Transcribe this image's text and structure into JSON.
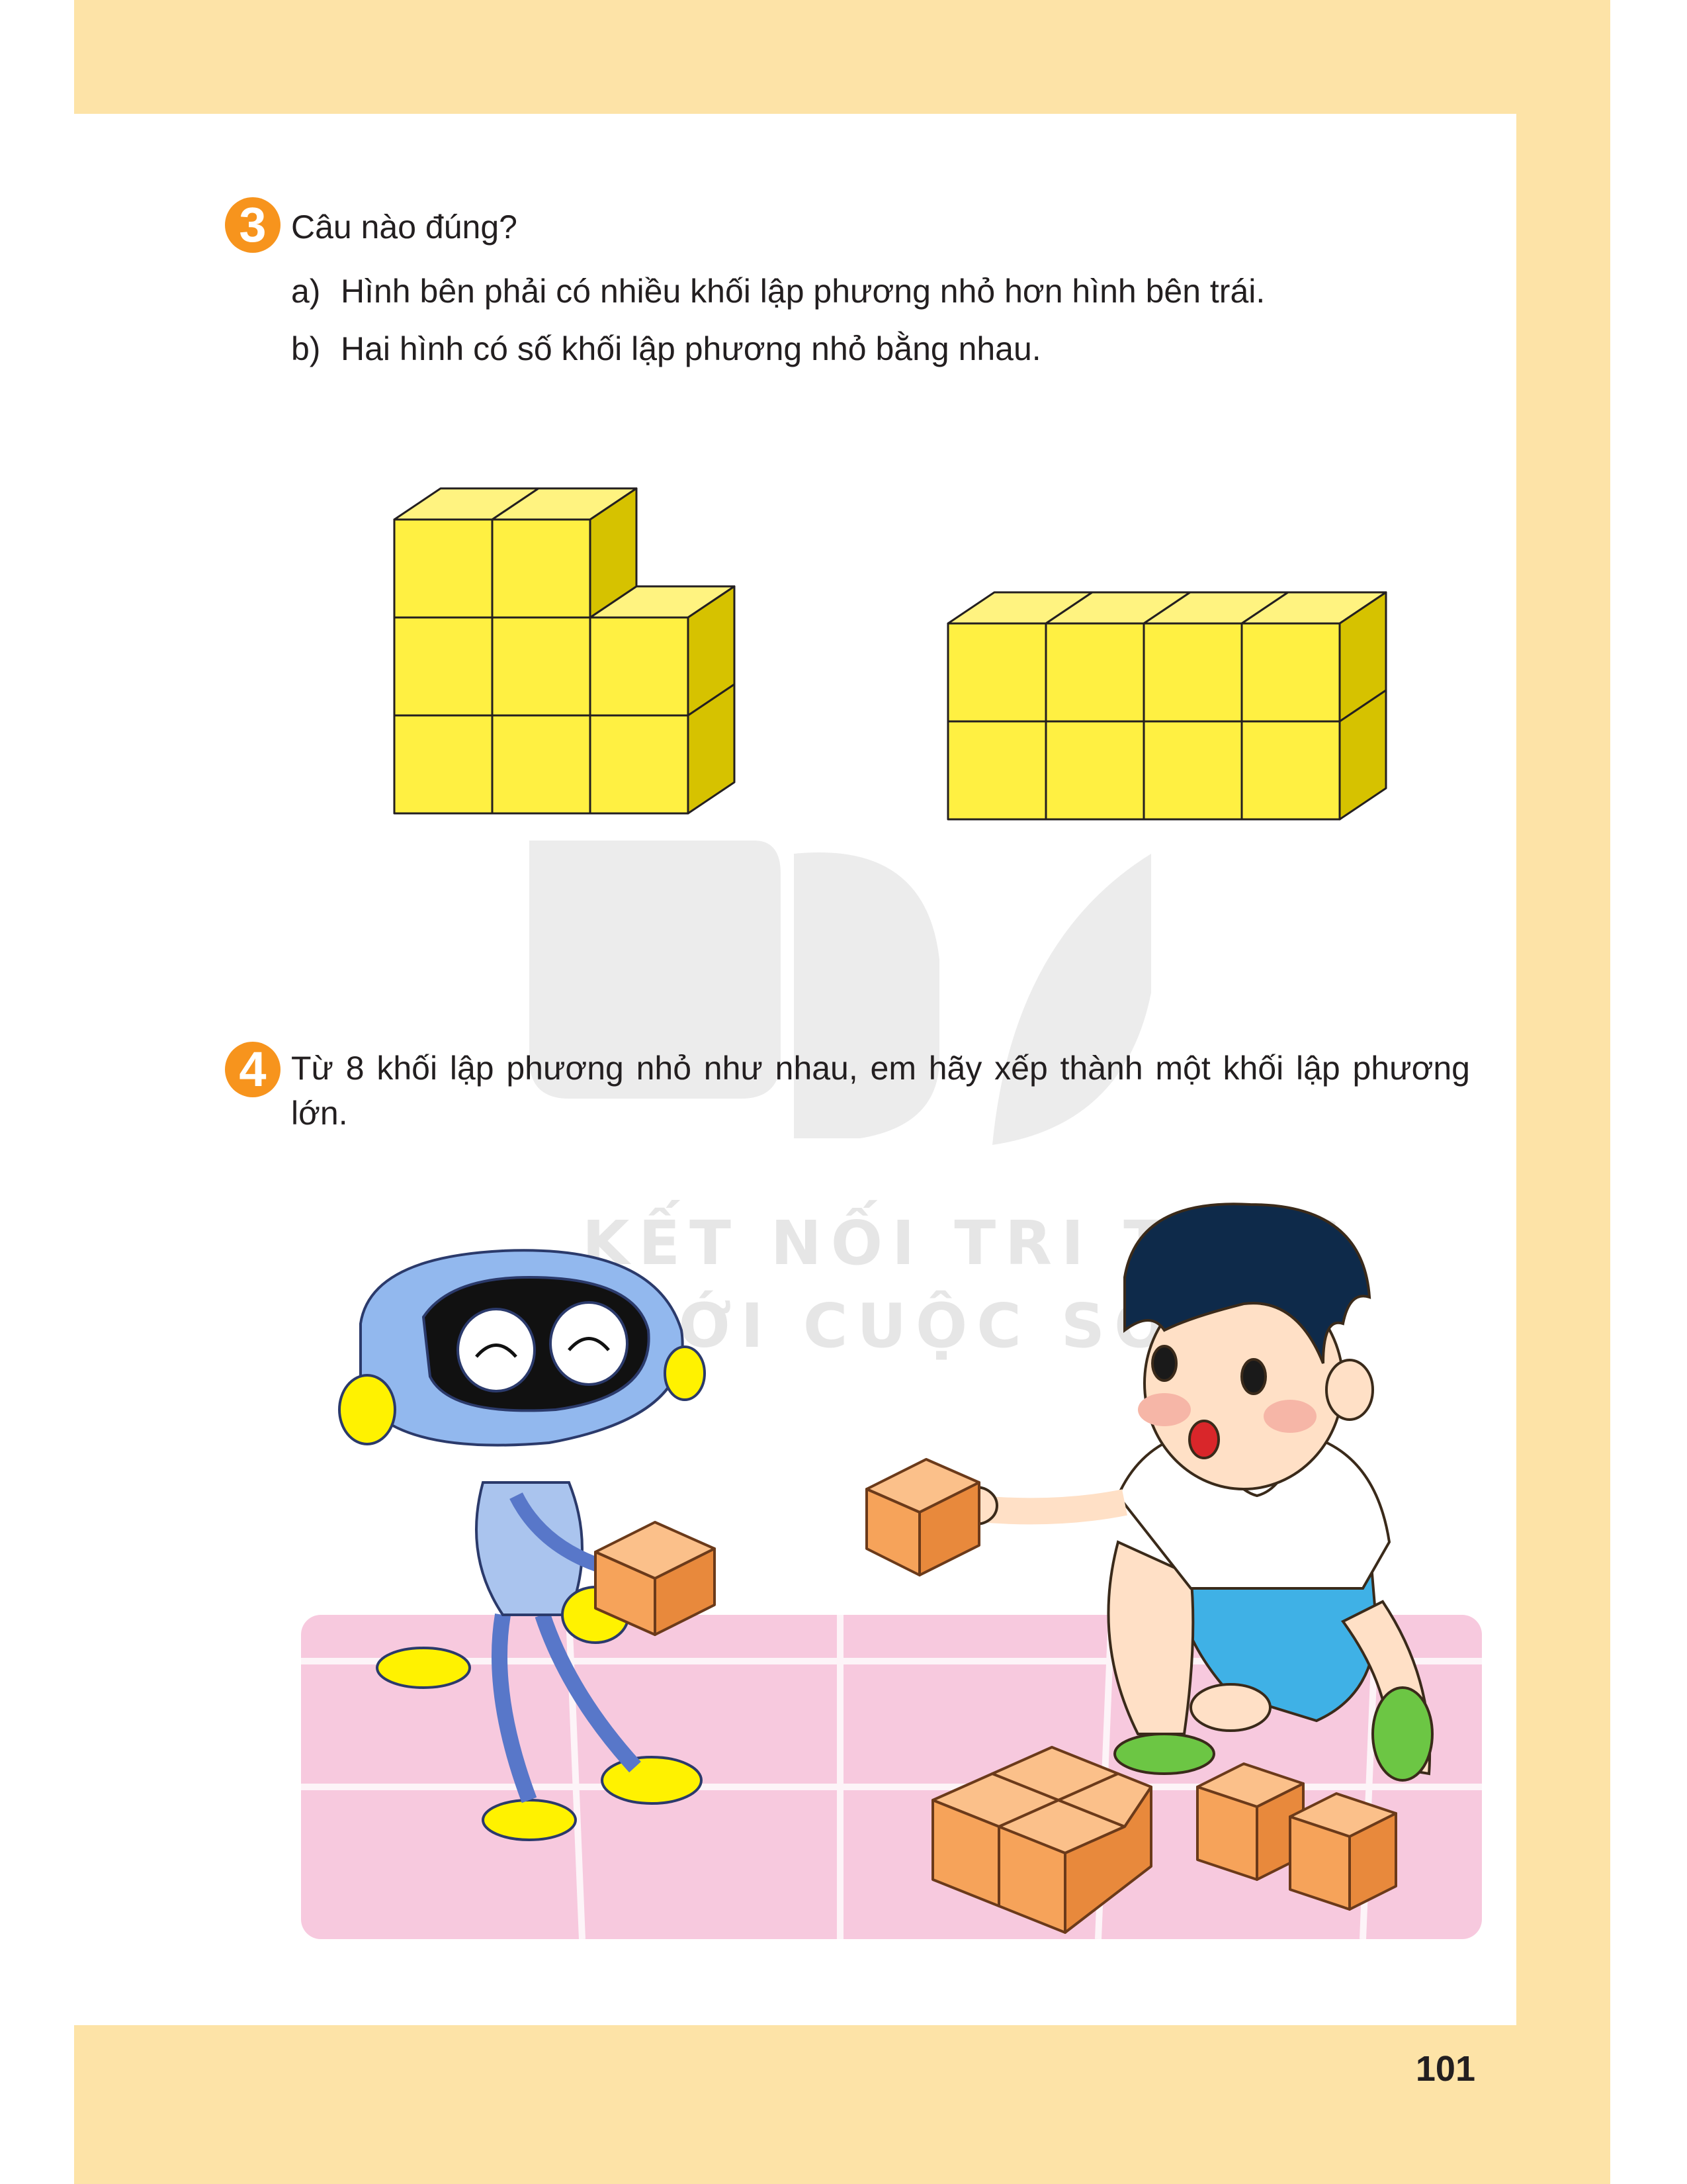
{
  "exercise3": {
    "number": "3",
    "question": "Câu nào đúng?",
    "options": [
      {
        "label": "a)",
        "text": "Hình bên phải có nhiều khối lập phương nhỏ hơn hình bên trái."
      },
      {
        "label": "b)",
        "text": "Hai hình có số khối lập phương nhỏ bằng nhau."
      }
    ]
  },
  "exercise4": {
    "number": "4",
    "text": "Từ 8 khối lập phương nhỏ như nhau, em hãy xếp thành một khối lập phương lớn."
  },
  "watermark": {
    "line1": "KẾT NỐI TRI THỨC",
    "line2": "VỚI CUỘC SỐNG"
  },
  "page_number": "101",
  "colors": {
    "band": "#fde3a7",
    "badge": "#f7941d",
    "cube_front": "#fff042",
    "cube_top": "#fff380",
    "cube_side": "#d6c200",
    "orange_cube": "#f6a35a",
    "floor": "#f7c9de"
  }
}
